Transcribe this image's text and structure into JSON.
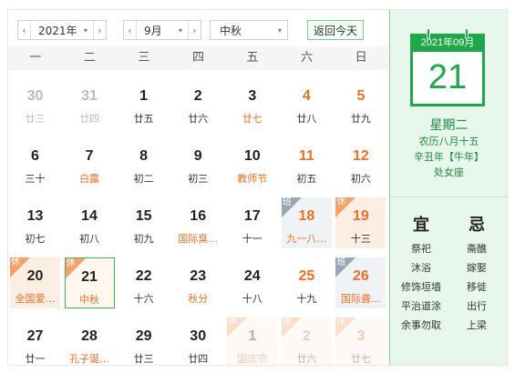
{
  "toolbar": {
    "year_value": "2021年",
    "month_value": "9月",
    "holiday_value": "中秋",
    "today_label": "返回今天",
    "prev_arrow": "‹",
    "next_arrow": "›",
    "caret": "▾"
  },
  "weekdays": [
    "一",
    "二",
    "三",
    "四",
    "五",
    "六",
    "日"
  ],
  "days": [
    {
      "d": "30",
      "l": "廿三",
      "cls": "other"
    },
    {
      "d": "31",
      "l": "廿四",
      "cls": "other"
    },
    {
      "d": "1",
      "l": "廿五",
      "cls": ""
    },
    {
      "d": "2",
      "l": "廿六",
      "cls": ""
    },
    {
      "d": "3",
      "l": "廿七",
      "cls": "fes"
    },
    {
      "d": "4",
      "l": "廿八",
      "cls": "wk"
    },
    {
      "d": "5",
      "l": "廿九",
      "cls": "wk"
    },
    {
      "d": "6",
      "l": "三十",
      "cls": ""
    },
    {
      "d": "7",
      "l": "白露",
      "cls": "fes"
    },
    {
      "d": "8",
      "l": "初二",
      "cls": ""
    },
    {
      "d": "9",
      "l": "初三",
      "cls": ""
    },
    {
      "d": "10",
      "l": "教师节",
      "cls": "fes"
    },
    {
      "d": "11",
      "l": "初五",
      "cls": "wk"
    },
    {
      "d": "12",
      "l": "初六",
      "cls": "wk"
    },
    {
      "d": "13",
      "l": "初七",
      "cls": ""
    },
    {
      "d": "14",
      "l": "初八",
      "cls": ""
    },
    {
      "d": "15",
      "l": "初九",
      "cls": ""
    },
    {
      "d": "16",
      "l": "国际臭…",
      "cls": "fes"
    },
    {
      "d": "17",
      "l": "十一",
      "cls": ""
    },
    {
      "d": "18",
      "l": "九一八…",
      "cls": "wk fes workday",
      "tag": "班"
    },
    {
      "d": "19",
      "l": "十三",
      "cls": "wk holiday",
      "tag": "休"
    },
    {
      "d": "20",
      "l": "全国爱…",
      "cls": "fes holiday",
      "tag": "休"
    },
    {
      "d": "21",
      "l": "中秋",
      "cls": "fes holiday sel",
      "tag": "休"
    },
    {
      "d": "22",
      "l": "十六",
      "cls": ""
    },
    {
      "d": "23",
      "l": "秋分",
      "cls": "fes"
    },
    {
      "d": "24",
      "l": "十八",
      "cls": ""
    },
    {
      "d": "25",
      "l": "十九",
      "cls": "wk"
    },
    {
      "d": "26",
      "l": "国际聋…",
      "cls": "wk fes workday",
      "tag": "班"
    },
    {
      "d": "27",
      "l": "廿一",
      "cls": ""
    },
    {
      "d": "28",
      "l": "孔子诞…",
      "cls": "fes"
    },
    {
      "d": "29",
      "l": "廿三",
      "cls": ""
    },
    {
      "d": "30",
      "l": "廿四",
      "cls": ""
    },
    {
      "d": "1",
      "l": "国庆节",
      "cls": "fes holiday faded",
      "tag": "休"
    },
    {
      "d": "2",
      "l": "廿六",
      "cls": "wk holiday faded",
      "tag": "休"
    },
    {
      "d": "3",
      "l": "廿七",
      "cls": "wk holiday faded",
      "tag": "休"
    }
  ],
  "detail": {
    "month_header": "2021年09月",
    "day": "21",
    "weekday": "星期二",
    "lunar": "农历八月十五",
    "ganzhi": "辛丑年【牛年】",
    "constellation": "处女座",
    "yi_title": "宜",
    "ji_title": "忌",
    "yi": [
      "祭祀",
      "沐浴",
      "修饰垣墙",
      "平治道涂",
      "余事勿取"
    ],
    "ji": [
      "斋醮",
      "嫁娶",
      "移徙",
      "出行",
      "上梁"
    ]
  },
  "colors": {
    "accent": "#1fa84a",
    "weekend": "#f06e24",
    "holiday_bg": "#fdeee3",
    "selected_border": "#3fb161"
  }
}
